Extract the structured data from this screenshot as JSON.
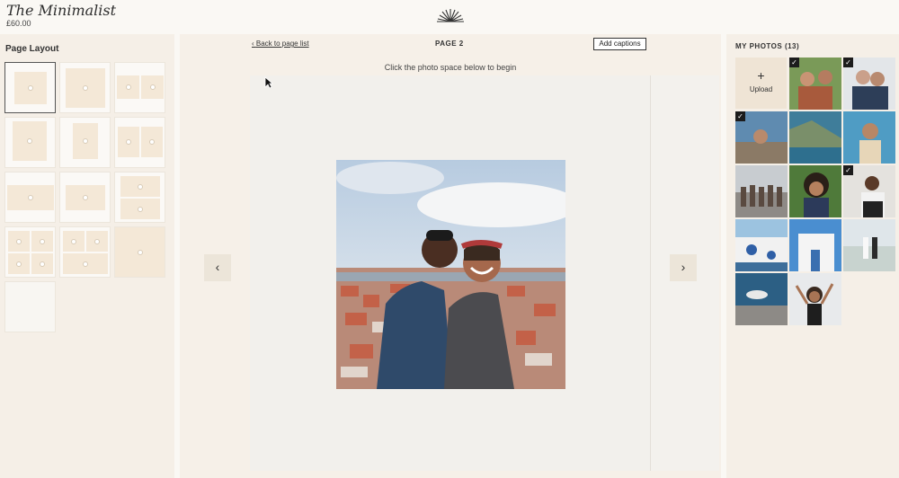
{
  "brand": {
    "title": "The Minimalist",
    "price": "£60.00"
  },
  "left": {
    "heading": "Page Layout"
  },
  "center": {
    "back_label": "Back to page list",
    "page_label": "PAGE 2",
    "captions_label": "Add captions",
    "hint": "Click the photo space below to begin",
    "prev_label": "‹",
    "next_label": "›"
  },
  "right": {
    "heading": "MY PHOTOS (13)",
    "upload_label": "Upload",
    "upload_plus": "+",
    "check_glyph": "✓"
  },
  "colors": {
    "accent": "#f4e8d7",
    "panel": "#f5efe7",
    "check": "#1c1c1c"
  }
}
